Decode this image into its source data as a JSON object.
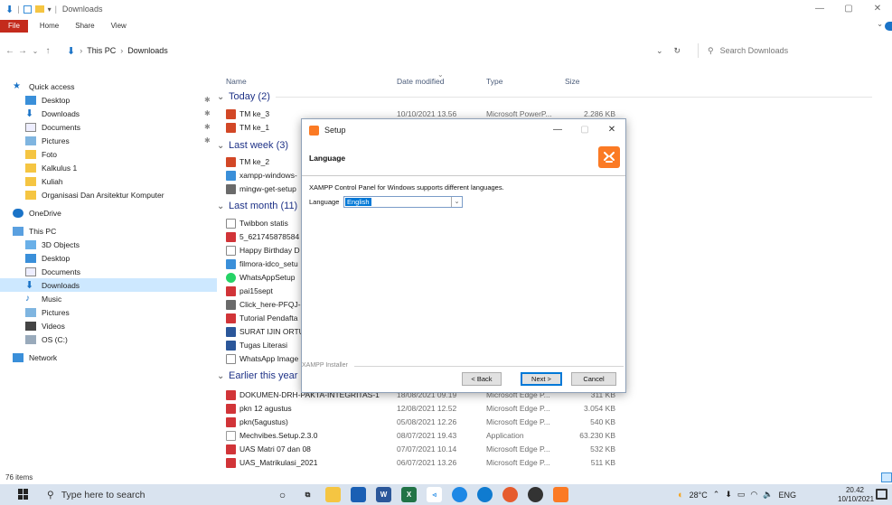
{
  "window": {
    "title": "Downloads",
    "controls": [
      "—",
      "▢",
      "✕"
    ]
  },
  "ribbon": {
    "tabs": [
      "File",
      "Home",
      "Share",
      "View"
    ]
  },
  "address": {
    "path": [
      "This PC",
      "Downloads"
    ],
    "search_placeholder": "Search Downloads"
  },
  "nav": {
    "quick_access": "Quick access",
    "quick_items": [
      {
        "label": "Desktop",
        "pinned": true
      },
      {
        "label": "Downloads",
        "pinned": true
      },
      {
        "label": "Documents",
        "pinned": true
      },
      {
        "label": "Pictures",
        "pinned": true
      },
      {
        "label": "Foto",
        "pinned": false
      },
      {
        "label": "Kalkulus 1",
        "pinned": false
      },
      {
        "label": "Kuliah",
        "pinned": false
      },
      {
        "label": "Organisasi Dan Arsitektur Komputer",
        "pinned": false
      }
    ],
    "onedrive": "OneDrive",
    "this_pc": "This PC",
    "pc_items": [
      "3D Objects",
      "Desktop",
      "Documents",
      "Downloads",
      "Music",
      "Pictures",
      "Videos",
      "OS (C:)"
    ],
    "network": "Network"
  },
  "columns": {
    "name": "Name",
    "date": "Date modified",
    "type": "Type",
    "size": "Size"
  },
  "groups": {
    "today": "Today (2)",
    "last_week": "Last week (3)",
    "last_month": "Last month (11)",
    "earlier": "Earlier this year"
  },
  "files": {
    "today": [
      {
        "name": "TM ke_3",
        "date": "10/10/2021 13.56",
        "type": "Microsoft PowerP...",
        "size": "2.286 KB"
      },
      {
        "name": "TM ke_1",
        "date": "",
        "type": "",
        "size": ""
      }
    ],
    "last_week": [
      {
        "name": "TM ke_2"
      },
      {
        "name": "xampp-windows-"
      },
      {
        "name": "mingw-get-setup"
      }
    ],
    "last_month": [
      {
        "name": "Twibbon statis"
      },
      {
        "name": "5_621745878584"
      },
      {
        "name": "Happy Birthday D"
      },
      {
        "name": "filmora-idco_setu"
      },
      {
        "name": "WhatsAppSetup"
      },
      {
        "name": "pai15sept"
      },
      {
        "name": "Click_here-PFQJ-"
      },
      {
        "name": "Tutorial Pendafta"
      },
      {
        "name": "SURAT IJIN ORTU"
      },
      {
        "name": "Tugas Literasi"
      },
      {
        "name": "WhatsApp Image"
      }
    ],
    "earlier": [
      {
        "name": "DOKUMEN-DRH-PAKTA-INTEGRITAS-1",
        "date": "18/08/2021 09.19",
        "type": "Microsoft Edge P...",
        "size": "311 KB"
      },
      {
        "name": "pkn 12 agustus",
        "date": "12/08/2021 12.52",
        "type": "Microsoft Edge P...",
        "size": "3.054 KB"
      },
      {
        "name": "pkn(5agustus)",
        "date": "05/08/2021 12.26",
        "type": "Microsoft Edge P...",
        "size": "540 KB"
      },
      {
        "name": "Mechvibes.Setup.2.3.0",
        "date": "08/07/2021 19.43",
        "type": "Application",
        "size": "63.230 KB"
      },
      {
        "name": "UAS Matri 07 dan 08",
        "date": "07/07/2021 10.14",
        "type": "Microsoft Edge P...",
        "size": "532 KB"
      },
      {
        "name": "UAS_Matrikulasi_2021",
        "date": "06/07/2021 13.26",
        "type": "Microsoft Edge P...",
        "size": "511 KB"
      }
    ]
  },
  "status": {
    "items": "76 items"
  },
  "dialog": {
    "title": "Setup",
    "header": "Language",
    "description": "XAMPP Control Panel for Windows supports different languages.",
    "language_label": "Language",
    "language_value": "English",
    "installer_label": "XAMPP Installer",
    "back_label": "< Back",
    "next_label": "Next >",
    "cancel_label": "Cancel"
  },
  "taskbar": {
    "search_placeholder": "Type here to search",
    "weather": "28°C",
    "lang": "ENG",
    "time": "20.42",
    "date": "10/10/2021"
  },
  "icons": {
    "file_tab_color": "#c42b1c",
    "selection_color": "#cde8ff",
    "xampp_color": "#fb7a24",
    "group_color": "#1e3287"
  }
}
